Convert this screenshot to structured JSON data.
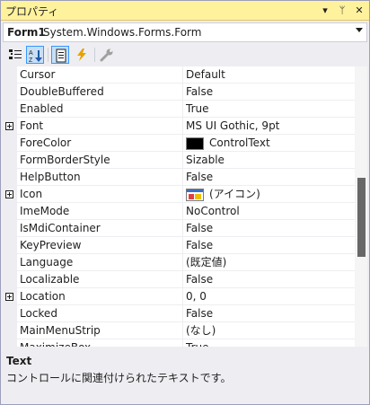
{
  "window": {
    "title": "プロパティ",
    "buttons": {
      "dropdown": "▾",
      "pin": "ᛘ",
      "close": "✕"
    }
  },
  "object_selector": {
    "name": "Form1",
    "type": "System.Windows.Forms.Form"
  },
  "toolbar": {
    "items": [
      {
        "name": "categorized",
        "icon": "categorized-icon",
        "pressed": false
      },
      {
        "name": "alphabetical",
        "icon": "alphabetical-icon",
        "pressed": true
      },
      {
        "name": "properties",
        "icon": "properties-icon",
        "pressed": true
      },
      {
        "name": "events",
        "icon": "lightning-icon",
        "pressed": false
      },
      {
        "name": "property-pages",
        "icon": "wrench-icon",
        "pressed": false
      }
    ]
  },
  "grid": {
    "rows": [
      {
        "name": "Cursor",
        "value": "Default",
        "expandable": false
      },
      {
        "name": "DoubleBuffered",
        "value": "False",
        "expandable": false
      },
      {
        "name": "Enabled",
        "value": "True",
        "expandable": false
      },
      {
        "name": "Font",
        "value": "MS UI Gothic, 9pt",
        "expandable": true
      },
      {
        "name": "ForeColor",
        "value": "ControlText",
        "expandable": false,
        "swatch": "#000000"
      },
      {
        "name": "FormBorderStyle",
        "value": "Sizable",
        "expandable": false
      },
      {
        "name": "HelpButton",
        "value": "False",
        "expandable": false
      },
      {
        "name": "Icon",
        "value": "(アイコン)",
        "expandable": true,
        "thumb": true
      },
      {
        "name": "ImeMode",
        "value": "NoControl",
        "expandable": false
      },
      {
        "name": "IsMdiContainer",
        "value": "False",
        "expandable": false
      },
      {
        "name": "KeyPreview",
        "value": "False",
        "expandable": false
      },
      {
        "name": "Language",
        "value": "(既定値)",
        "expandable": false
      },
      {
        "name": "Localizable",
        "value": "False",
        "expandable": false
      },
      {
        "name": "Location",
        "value": "0, 0",
        "expandable": true
      },
      {
        "name": "Locked",
        "value": "False",
        "expandable": false
      },
      {
        "name": "MainMenuStrip",
        "value": "(なし)",
        "expandable": false
      },
      {
        "name": "MaximizeBox",
        "value": "True",
        "expandable": false
      }
    ]
  },
  "description": {
    "title": "Text",
    "text": "コントロールに関連付けられたテキストです。"
  },
  "colors": {
    "titlebar": "#fff29d",
    "panel": "#eeeef2",
    "accent": "#3399ff",
    "scroll_thumb": "#686868"
  }
}
